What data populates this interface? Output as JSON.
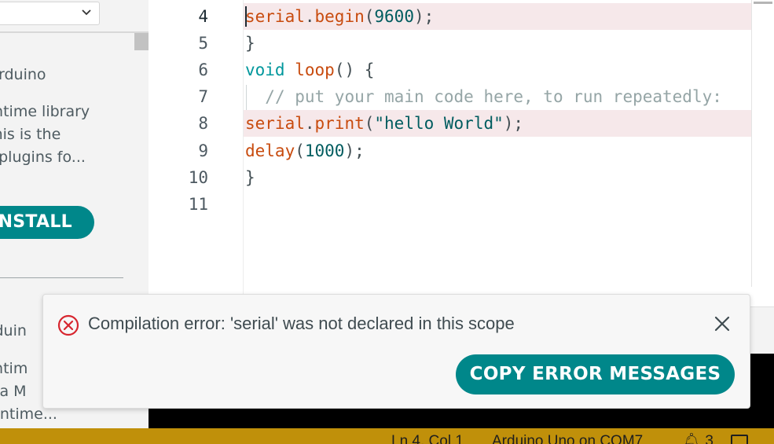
{
  "library_panel": {
    "item1_title": "Arduino",
    "item1_desc": [
      "untime library",
      "This is the",
      "d plugins fo..."
    ],
    "install_label": "NSTALL",
    "item2_title": "rduin",
    "item2_desc": [
      "untim",
      "nta M",
      "runtime..."
    ]
  },
  "editor": {
    "lines": [
      {
        "n": "4",
        "active": true
      },
      {
        "n": "5"
      },
      {
        "n": "6"
      },
      {
        "n": "7"
      },
      {
        "n": "8"
      },
      {
        "n": "9"
      },
      {
        "n": "10"
      },
      {
        "n": "11"
      }
    ],
    "code": {
      "l4_fn": "serial",
      "l4_dot": ".",
      "l4_method": "begin",
      "l4_open": "(",
      "l4_num": "9600",
      "l4_close": ");",
      "l5": "}",
      "l6_type": "void",
      "l6_fn": "loop",
      "l6_rest": "() {",
      "l7_comment": "// put your main code here, to run repeatedly:",
      "l8_fn": "serial",
      "l8_dot": ".",
      "l8_method": "print",
      "l8_open": "(",
      "l8_str": "\"hello World\"",
      "l8_close": ");",
      "l9_fn": "delay",
      "l9_open": "(",
      "l9_num": "1000",
      "l9_close": ");",
      "l10": "}"
    }
  },
  "notification": {
    "message": "Compilation error: 'serial' was not declared in this scope",
    "copy_button": "COPY ERROR MESSAGES"
  },
  "statusbar": {
    "position": "Ln 4, Col 1",
    "board": "Arduino Uno on COM7",
    "notifications": "3"
  },
  "colors": {
    "accent": "#00878a",
    "statusbar": "#c0900a",
    "error_line": "#f6e8ea",
    "error_icon": "#d7262f"
  }
}
